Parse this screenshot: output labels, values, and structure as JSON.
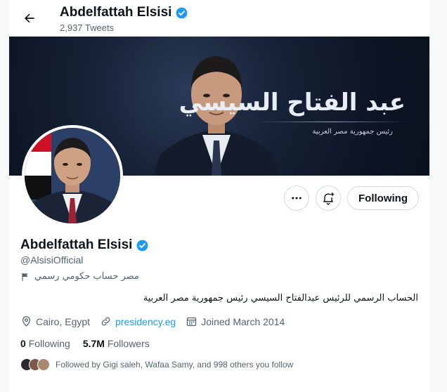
{
  "header": {
    "name": "Abdelfattah Elsisi",
    "tweet_count": "2,937 Tweets"
  },
  "banner": {
    "title_ar": "عبد الفتاح السيسي",
    "subtitle_ar": "رئيس جمهورية مصر العربية"
  },
  "actions": {
    "following_label": "Following"
  },
  "profile": {
    "name": "Abdelfattah Elsisi",
    "handle": "@AlsisiOfficial",
    "label_ar": "مصر حساب حكومي رسمي",
    "bio_ar": "الحساب الرسمي للرئيس عبدالفتاح السيسي رئيس جمهورية مصر العربية",
    "location": "Cairo, Egypt",
    "website": "presidency.eg",
    "joined": "Joined March 2014"
  },
  "counts": {
    "following_num": "0",
    "following_label": "Following",
    "followers_num": "5.7M",
    "followers_label": "Followers"
  },
  "followed_by": "Followed by Gigi saleh, Wafaa Samy, and 998 others you follow",
  "colors": {
    "accent": "#1d9bf0",
    "text": "#0f1419",
    "muted": "#536471",
    "border": "#cfd9de"
  },
  "icons": {
    "back": "arrow-left-icon",
    "verified": "verified-badge-icon",
    "more": "more-dots-icon",
    "notify": "bell-plus-icon",
    "flag": "flag-icon",
    "location": "location-pin-icon",
    "link": "link-icon",
    "calendar": "calendar-icon"
  }
}
